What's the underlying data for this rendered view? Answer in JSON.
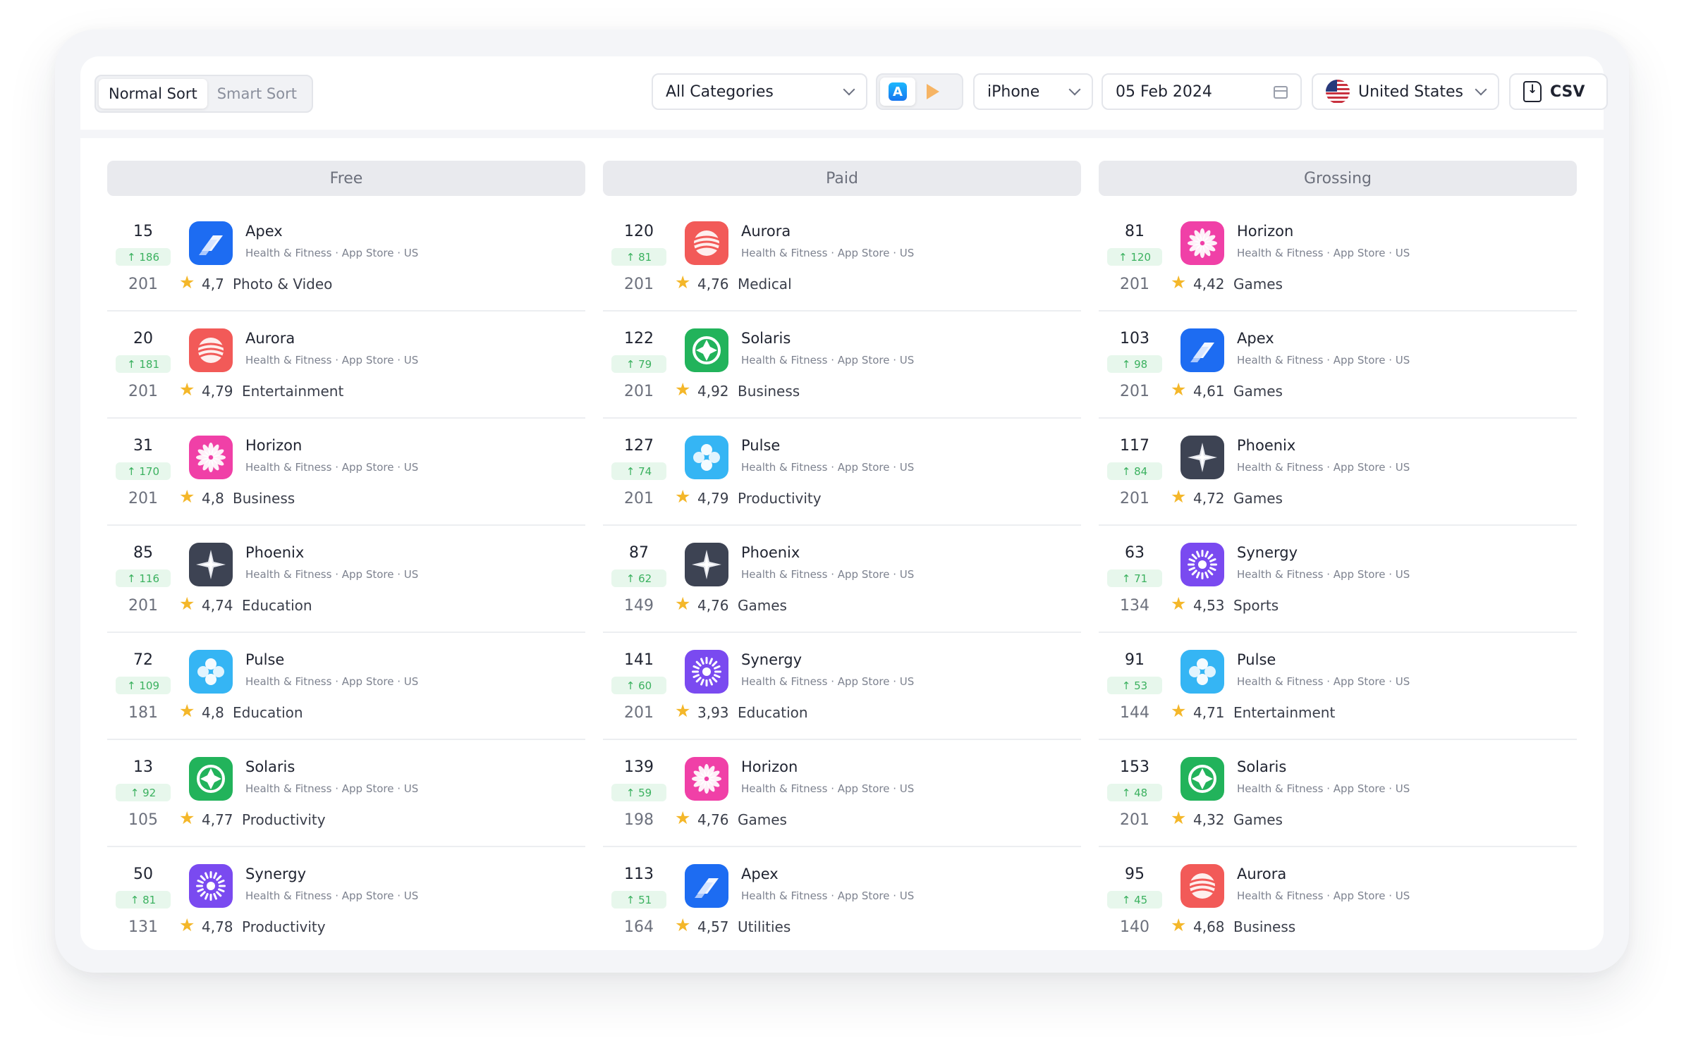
{
  "toolbar": {
    "sort_normal": "Normal Sort",
    "sort_smart": "Smart Sort",
    "category": "All Categories",
    "device": "iPhone",
    "date": "05 Feb 2024",
    "country": "United States",
    "csv": "CSV"
  },
  "colors": {
    "apex": "#1d6cf2",
    "aurora": "#f25a58",
    "horizon": "#f040a7",
    "solaris": "#22b35b",
    "pulse": "#35b5f4",
    "phoenix": "#3d4353",
    "synergy": "#7a4af0",
    "change_green": "#3bb15f",
    "star": "#f4b72a"
  },
  "meta_text": "Health & Fitness · App Store · US",
  "columns": [
    {
      "title": "Free",
      "rows": [
        {
          "rank": "15",
          "change": "↑ 186",
          "total": "201",
          "name": "Apex",
          "icon": "apex",
          "rating": "4,7",
          "category": "Photo & Video"
        },
        {
          "rank": "20",
          "change": "↑ 181",
          "total": "201",
          "name": "Aurora",
          "icon": "aurora",
          "rating": "4,79",
          "category": "Entertainment"
        },
        {
          "rank": "31",
          "change": "↑ 170",
          "total": "201",
          "name": "Horizon",
          "icon": "horizon",
          "rating": "4,8",
          "category": "Business"
        },
        {
          "rank": "85",
          "change": "↑ 116",
          "total": "201",
          "name": "Phoenix",
          "icon": "phoenix",
          "rating": "4,74",
          "category": "Education"
        },
        {
          "rank": "72",
          "change": "↑ 109",
          "total": "181",
          "name": "Pulse",
          "icon": "pulse",
          "rating": "4,8",
          "category": "Education"
        },
        {
          "rank": "13",
          "change": "↑ 92",
          "total": "105",
          "name": "Solaris",
          "icon": "solaris",
          "rating": "4,77",
          "category": "Productivity"
        },
        {
          "rank": "50",
          "change": "↑ 81",
          "total": "131",
          "name": "Synergy",
          "icon": "synergy",
          "rating": "4,78",
          "category": "Productivity"
        }
      ]
    },
    {
      "title": "Paid",
      "rows": [
        {
          "rank": "120",
          "change": "↑ 81",
          "total": "201",
          "name": "Aurora",
          "icon": "aurora",
          "rating": "4,76",
          "category": "Medical"
        },
        {
          "rank": "122",
          "change": "↑ 79",
          "total": "201",
          "name": "Solaris",
          "icon": "solaris",
          "rating": "4,92",
          "category": "Business"
        },
        {
          "rank": "127",
          "change": "↑ 74",
          "total": "201",
          "name": "Pulse",
          "icon": "pulse",
          "rating": "4,79",
          "category": "Productivity"
        },
        {
          "rank": "87",
          "change": "↑ 62",
          "total": "149",
          "name": "Phoenix",
          "icon": "phoenix",
          "rating": "4,76",
          "category": "Games"
        },
        {
          "rank": "141",
          "change": "↑ 60",
          "total": "201",
          "name": "Synergy",
          "icon": "synergy",
          "rating": "3,93",
          "category": "Education"
        },
        {
          "rank": "139",
          "change": "↑ 59",
          "total": "198",
          "name": "Horizon",
          "icon": "horizon",
          "rating": "4,76",
          "category": "Games"
        },
        {
          "rank": "113",
          "change": "↑ 51",
          "total": "164",
          "name": "Apex",
          "icon": "apex",
          "rating": "4,57",
          "category": "Utilities"
        }
      ]
    },
    {
      "title": "Grossing",
      "rows": [
        {
          "rank": "81",
          "change": "↑ 120",
          "total": "201",
          "name": "Horizon",
          "icon": "horizon",
          "rating": "4,42",
          "category": "Games"
        },
        {
          "rank": "103",
          "change": "↑ 98",
          "total": "201",
          "name": "Apex",
          "icon": "apex",
          "rating": "4,61",
          "category": "Games"
        },
        {
          "rank": "117",
          "change": "↑ 84",
          "total": "201",
          "name": "Phoenix",
          "icon": "phoenix",
          "rating": "4,72",
          "category": "Games"
        },
        {
          "rank": "63",
          "change": "↑ 71",
          "total": "134",
          "name": "Synergy",
          "icon": "synergy",
          "rating": "4,53",
          "category": "Sports"
        },
        {
          "rank": "91",
          "change": "↑ 53",
          "total": "144",
          "name": "Pulse",
          "icon": "pulse",
          "rating": "4,71",
          "category": "Entertainment"
        },
        {
          "rank": "153",
          "change": "↑ 48",
          "total": "201",
          "name": "Solaris",
          "icon": "solaris",
          "rating": "4,32",
          "category": "Games"
        },
        {
          "rank": "95",
          "change": "↑ 45",
          "total": "140",
          "name": "Aurora",
          "icon": "aurora",
          "rating": "4,68",
          "category": "Business"
        }
      ]
    }
  ]
}
